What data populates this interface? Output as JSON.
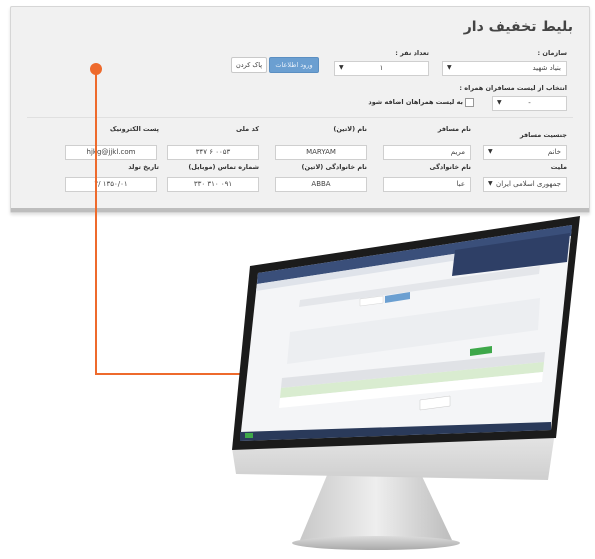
{
  "panel": {
    "title": "بلیط تخفیف دار",
    "organization": {
      "label": "سازمان :",
      "value": "بنیاد شهید"
    },
    "count": {
      "label": "تعداد نفر :",
      "value": "۱"
    },
    "submit_label": "ورود اطلاعات",
    "clear_label": "پاک کردن",
    "companion": {
      "label": "انتخاب از لیست مسافران همراه :",
      "value": "-"
    },
    "add_to_list_label": "به لیست همراهان اضافه شود",
    "passenger": {
      "gender": {
        "label": "جنسیت مسافر",
        "value": "خانم"
      },
      "name": {
        "label": "نام مسافر",
        "value": "مریم"
      },
      "latin_name": {
        "label": "نام (لاتین)",
        "value": "MARYAM"
      },
      "national_code": {
        "label": "کد ملی",
        "value": "۰۰۵۳ ۶ ۳۴۷"
      },
      "email": {
        "label": "پست الکترونیک",
        "value": "hjkg@jjkl.com"
      },
      "nationality": {
        "label": "ملیت",
        "value": "جمهوری اسلامی ایران"
      },
      "family": {
        "label": "نام خانوادگی",
        "value": "عبا"
      },
      "latin_family": {
        "label": "نام خانوادگی (لاتین)",
        "value": "ABBA"
      },
      "mobile": {
        "label": "شماره تماس (موبایل)",
        "value": "۰۹۱ ۳۱۰ ۳۳۰"
      },
      "birth_date": {
        "label": "تاریخ تولد",
        "value": "۱۳۵۰/۰۱ /۲"
      }
    }
  },
  "colors": {
    "accent": "#ee6a2c",
    "button_primary": "#6b9fd1",
    "panel_bg": "#f1f1f1"
  }
}
